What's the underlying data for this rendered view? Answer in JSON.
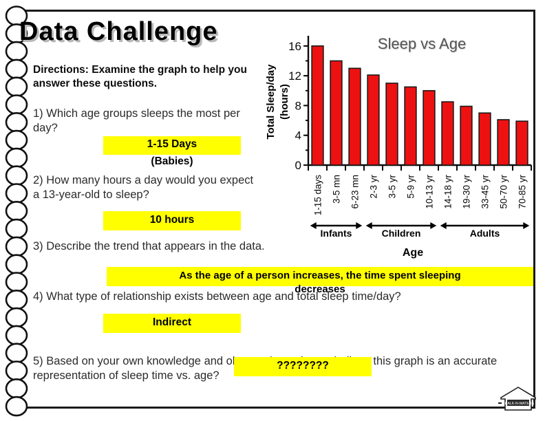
{
  "slide": {
    "title": "Data Challenge",
    "directions": "Directions:  Examine the graph to help you answer these questions."
  },
  "questions": [
    {
      "id": "q1",
      "text": "1) Which age groups sleeps the most per day?",
      "answer": "1-15 Days",
      "answer_sub": "(Babies)"
    },
    {
      "id": "q2",
      "text": "2) How many hours a day would you expect a 13-year-old to sleep?",
      "answer": "10 hours"
    },
    {
      "id": "q3",
      "text": "3) Describe the trend that appears in the data.",
      "answer": "As the age of a person increases, the time spent sleeping",
      "answer_sub": "decreases"
    },
    {
      "id": "q4",
      "text": "4) What type of relationship exists between age and total sleep time/day?",
      "answer": "Indirect"
    },
    {
      "id": "q5",
      "text": "5)  Based on your own knowledge and observations, do you believe this graph is an accurate representation of sleep time vs. age?",
      "answer": "????????"
    }
  ],
  "logo": {
    "label": "CHALK-N-WATERS"
  },
  "chart_data": {
    "type": "bar",
    "title": "Sleep vs Age",
    "xlabel": "Age",
    "ylabel": "Total Sleep/day (hours)",
    "ylim": [
      0,
      17
    ],
    "yticks": [
      0,
      4,
      8,
      12,
      16
    ],
    "grid": false,
    "legend": "none",
    "bar_color": "#ee1111",
    "bar_edge_color": "#1a1a1a",
    "categories": [
      "1-15 days",
      "3-5 mn",
      "6-23 mn",
      "2-3 yr",
      "3-5 yr",
      "5-9 yr",
      "10-13 yr",
      "14-18 yr",
      "19-30 yr",
      "33-45 yr",
      "50-70 yr",
      "70-85 yr"
    ],
    "values": [
      16.0,
      14.0,
      13.0,
      12.1,
      11.0,
      10.5,
      10.0,
      8.5,
      7.9,
      7.0,
      6.1,
      5.9
    ],
    "groups": [
      {
        "label": "Infants",
        "start_index": 0,
        "end_index": 2
      },
      {
        "label": "Children",
        "start_index": 3,
        "end_index": 6
      },
      {
        "label": "Adults",
        "start_index": 7,
        "end_index": 11
      }
    ]
  }
}
